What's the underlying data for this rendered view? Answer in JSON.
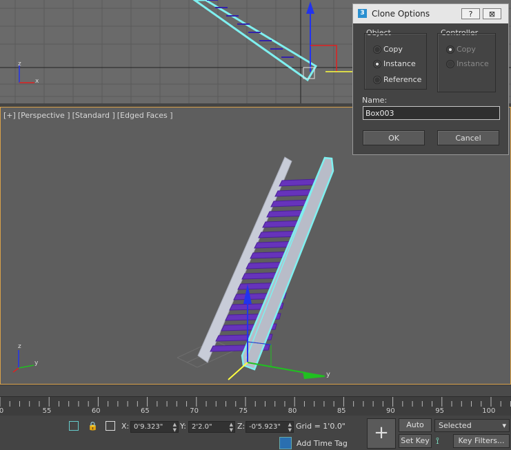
{
  "dialog": {
    "title": "Clone Options",
    "app_icon": "3",
    "help_label": "?",
    "close_label": "⊠",
    "object_group": {
      "title": "Object",
      "options": [
        "Copy",
        "Instance",
        "Reference"
      ],
      "selected": "Instance"
    },
    "controller_group": {
      "title": "Controller",
      "options": [
        "Copy",
        "Instance"
      ],
      "selected": "Copy",
      "disabled": true
    },
    "name_label": "Name:",
    "name_value": "Box003",
    "ok_label": "OK",
    "cancel_label": "Cancel"
  },
  "viewport_label": {
    "plus": "[+]",
    "view": "[Perspective ]",
    "shading": "[Standard ]",
    "mode": "[Edged Faces ]"
  },
  "gizmo_axes": {
    "x": "x",
    "y": "y",
    "z": "z"
  },
  "timeline": {
    "ticks": [
      "0",
      "55",
      "60",
      "65",
      "70",
      "75",
      "80",
      "85",
      "90",
      "95",
      "100"
    ]
  },
  "coords": {
    "x_label": "X:",
    "x_value": "0'9.323\"",
    "y_label": "Y:",
    "y_value": "2'2.0\"",
    "z_label": "Z:",
    "z_value": "-0'5.923\"",
    "grid": "Grid = 1'0.0\""
  },
  "add_time_tag": "Add Time Tag",
  "anim": {
    "auto_key": "Auto Key",
    "set_key": "Set Key",
    "selected": "Selected",
    "key_filters": "Key Filters..."
  },
  "colors": {
    "selection": "#7ff0f0",
    "steps": "#6633bb",
    "axis_x": "#e02020",
    "axis_y": "#20c020",
    "axis_z": "#2233ee",
    "viewport_border": "#d9a14a"
  }
}
